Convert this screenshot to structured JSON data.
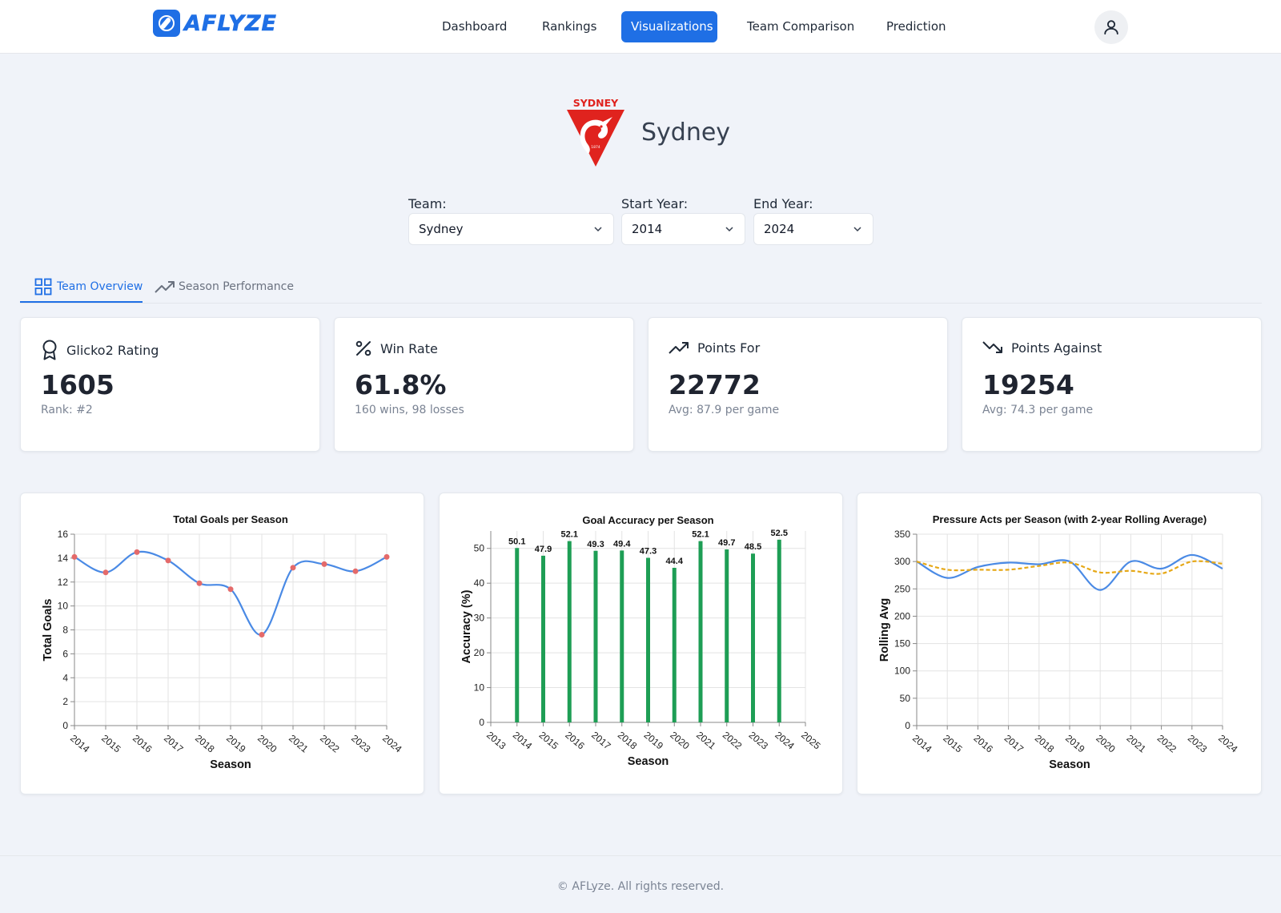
{
  "nav": {
    "brand": "AFLYZE",
    "items": [
      "Dashboard",
      "Rankings",
      "Visualizations",
      "Team Comparison",
      "Prediction"
    ],
    "active": "Visualizations"
  },
  "team": {
    "name": "Sydney",
    "logo_text": "SYDNEY",
    "logo_year": "1874",
    "logo_color": "#e0231e"
  },
  "filters": {
    "team_label": "Team:",
    "team_value": "Sydney",
    "start_label": "Start Year:",
    "start_value": "2014",
    "end_label": "End Year:",
    "end_value": "2024"
  },
  "tabs": {
    "overview": "Team Overview",
    "season": "Season Performance"
  },
  "stats": [
    {
      "title": "Glicko2 Rating",
      "value": "1605",
      "sub": "Rank: #2",
      "icon": "award-icon"
    },
    {
      "title": "Win Rate",
      "value": "61.8%",
      "sub": "160 wins, 98 losses",
      "icon": "percent-icon"
    },
    {
      "title": "Points For",
      "value": "22772",
      "sub": "Avg: 87.9 per game",
      "icon": "trending-up-icon"
    },
    {
      "title": "Points Against",
      "value": "19254",
      "sub": "Avg: 74.3 per game",
      "icon": "trending-down-icon"
    }
  ],
  "chart_data": [
    {
      "type": "line",
      "title": "Total Goals per Season",
      "xlabel": "Season",
      "ylabel": "Total Goals",
      "x": [
        2014,
        2015,
        2016,
        2017,
        2018,
        2019,
        2020,
        2021,
        2022,
        2023,
        2024
      ],
      "values": [
        14.1,
        12.8,
        14.5,
        13.8,
        11.9,
        11.4,
        7.6,
        13.2,
        13.5,
        12.9,
        14.1
      ],
      "ylim": [
        0,
        16
      ],
      "yticks": [
        0,
        2,
        4,
        6,
        8,
        10,
        12,
        14,
        16
      ],
      "grid": true,
      "line_color": "#4a8ae5",
      "marker_color": "#e46a6a"
    },
    {
      "type": "bar",
      "title": "Goal Accuracy per Season",
      "xlabel": "Season",
      "ylabel": "Accuracy (%)",
      "x": [
        2014,
        2015,
        2016,
        2017,
        2018,
        2019,
        2020,
        2021,
        2022,
        2023,
        2024
      ],
      "values": [
        50.1,
        47.9,
        52.1,
        49.3,
        49.4,
        47.3,
        44.4,
        52.1,
        49.7,
        48.5,
        52.5
      ],
      "xlim": [
        2013,
        2025
      ],
      "xticks": [
        2013,
        2014,
        2015,
        2016,
        2017,
        2018,
        2019,
        2020,
        2021,
        2022,
        2023,
        2024,
        2025
      ],
      "ylim": [
        0,
        55
      ],
      "yticks": [
        0,
        10,
        20,
        30,
        40,
        50
      ],
      "grid": true,
      "bar_color": "#1e9e55"
    },
    {
      "type": "line",
      "title": "Pressure Acts per Season (with 2-year Rolling Average)",
      "xlabel": "Season",
      "ylabel": "Rolling Avg",
      "x": [
        2014,
        2015,
        2016,
        2017,
        2018,
        2019,
        2020,
        2021,
        2022,
        2023,
        2024
      ],
      "series": [
        {
          "values": [
            300,
            270,
            290,
            298,
            295,
            300,
            248,
            300,
            287,
            312,
            287
          ],
          "color": "#4a8ae5",
          "style": "solid"
        },
        {
          "values": [
            300,
            285,
            285,
            285,
            292,
            298,
            280,
            283,
            278,
            300,
            296
          ],
          "color": "#e6a817",
          "style": "dashed"
        }
      ],
      "ylim": [
        0,
        350
      ],
      "yticks": [
        0,
        50,
        100,
        150,
        200,
        250,
        300,
        350
      ],
      "grid": true
    }
  ],
  "footer": "© AFLyze. All rights reserved."
}
